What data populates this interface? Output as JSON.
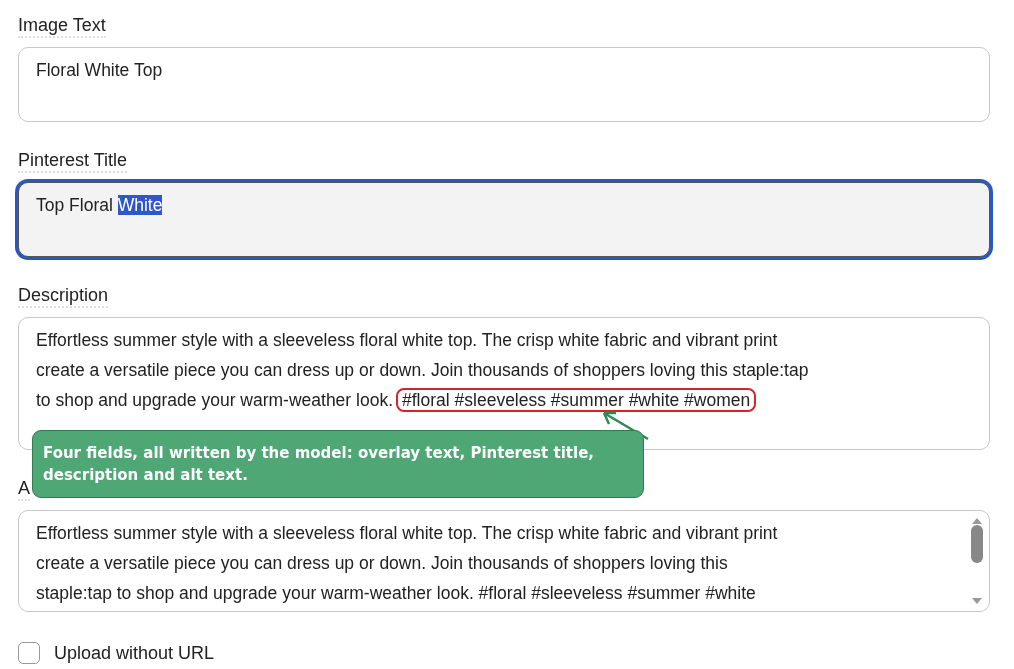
{
  "fields": [
    {
      "label": "Image Text",
      "focused": false,
      "scrollable": false,
      "lines": [
        [
          {
            "text": "Floral White Top",
            "kind": "plain"
          }
        ]
      ]
    },
    {
      "label": "Pinterest Title",
      "focused": true,
      "scrollable": false,
      "lines": [
        [
          {
            "text": "Top Floral ",
            "kind": "plain"
          },
          {
            "text": "White",
            "kind": "selection"
          }
        ]
      ]
    },
    {
      "label": "Description",
      "focused": false,
      "scrollable": false,
      "lines": [
        [
          {
            "text": "Effortless summer style with a sleeveless floral white top. The crisp white fabric and vibrant print",
            "kind": "plain"
          }
        ],
        [
          {
            "text": "create a versatile piece you can dress up or down. Join thousands of shoppers loving this staple:tap",
            "kind": "plain"
          }
        ],
        [
          {
            "text": "to shop and upgrade your warm-weather look.",
            "kind": "plain"
          },
          {
            "text": "#floral #sleeveless #summer #white #women",
            "kind": "circled"
          }
        ]
      ]
    },
    {
      "label": "A",
      "focused": false,
      "scrollable": true,
      "lines": [
        [
          {
            "text": "Effortless summer style with a sleeveless floral white top. The crisp white fabric and vibrant print",
            "kind": "plain"
          }
        ],
        [
          {
            "text": "create a versatile piece you can dress up or down. Join thousands of shoppers loving this",
            "kind": "plain"
          }
        ],
        [
          {
            "text": "staple:tap to shop and upgrade your warm-weather look. #floral #sleeveless #summer #white",
            "kind": "plain"
          }
        ]
      ]
    }
  ],
  "checkbox": {
    "label": "Upload without URL",
    "checked": false
  },
  "callout": {
    "text": "Four fields, all written by the model: overlay text, Pinterest title, description and alt text."
  }
}
